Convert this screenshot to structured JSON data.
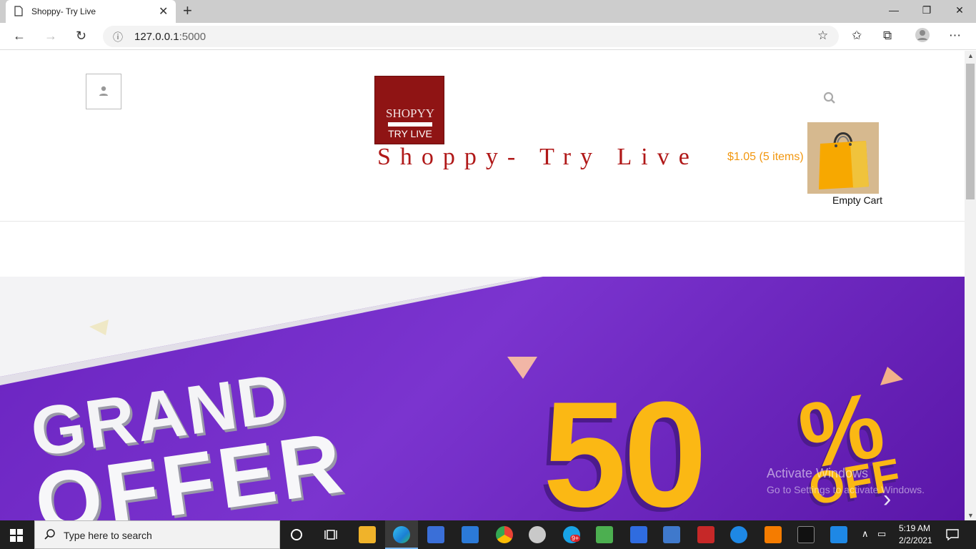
{
  "browser": {
    "tab_title": "Shoppy- Try Live",
    "tab_close": "✕",
    "new_tab": "+",
    "url_host": "127.0.0.1",
    "url_port": ":5000",
    "win_minimize": "—",
    "win_restore": "❐",
    "win_close": "✕"
  },
  "header": {
    "logo_top": "SHOPYY",
    "logo_bottom": "TRY LIVE",
    "site_title": "Shoppy- Try Live",
    "cart_total": "$1.05 (5 items)",
    "cart_label": "Empty Cart"
  },
  "banner": {
    "line1": "GRAND",
    "line2": "OFFER",
    "discount": "50",
    "percent": "%",
    "off": "OFF",
    "next": "›",
    "colors": {
      "purple": "#6a23c0",
      "gold": "#fbb814"
    }
  },
  "watermark": {
    "title": "Activate Windows",
    "subtitle": "Go to Settings to activate Windows."
  },
  "taskbar": {
    "search_placeholder": "Type here to search",
    "time": "5:19 AM",
    "date": "2/2/2021",
    "skype_badge": "9+"
  }
}
